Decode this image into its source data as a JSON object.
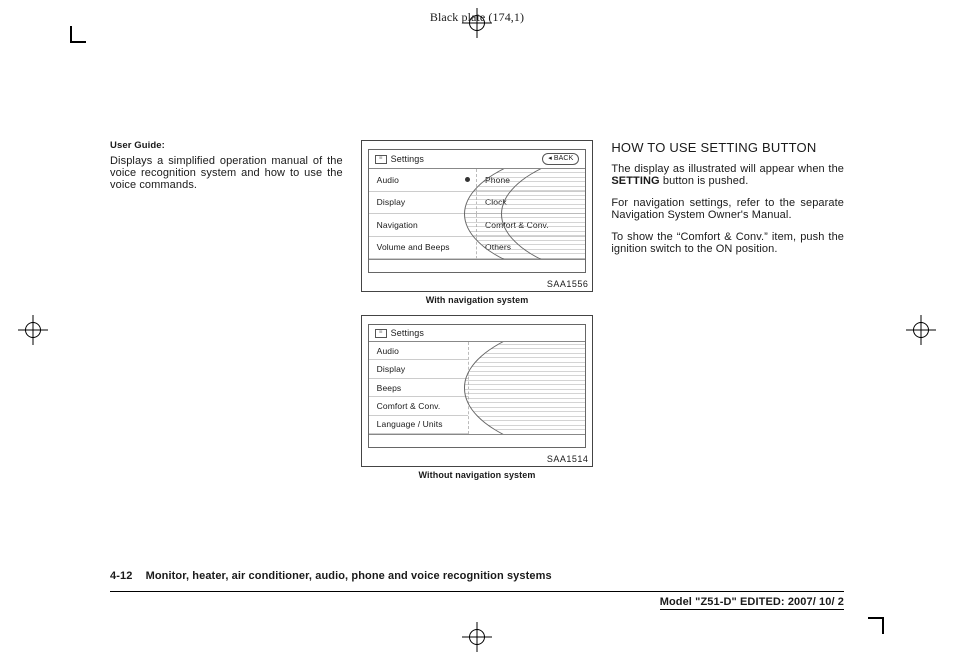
{
  "meta": {
    "plate_label": "Black plate (174,1)"
  },
  "col1": {
    "heading": "User Guide:",
    "paragraph": "Displays a simplified operation manual of the voice recognition system and how to use the voice commands."
  },
  "fig1": {
    "id": "SAA1556",
    "caption": "With navigation system",
    "title": "Settings",
    "back_label": "BACK",
    "menu_left": [
      "Audio",
      "Display",
      "Navigation",
      "Volume and Beeps"
    ],
    "menu_right": [
      "Phone",
      "Clock",
      "Comfort & Conv.",
      "Others"
    ]
  },
  "fig2": {
    "id": "SAA1514",
    "caption": "Without navigation system",
    "title": "Settings",
    "menu": [
      "Audio",
      "Display",
      "Beeps",
      "Comfort & Conv.",
      "Language / Units"
    ]
  },
  "col3": {
    "heading": "HOW TO USE SETTING BUTTON",
    "p1_a": "The display as illustrated will appear when the ",
    "p1_b_strong": "SETTING",
    "p1_c": " button is pushed.",
    "p2": "For navigation settings, refer to the separate Navigation System Owner's Manual.",
    "p3": "To show the “Comfort & Conv.” item, push the ignition switch to the ON position."
  },
  "footer": {
    "page": "4-12",
    "section": "Monitor, heater, air conditioner, audio, phone and voice recognition systems",
    "model_a": "Model ",
    "model_b": "\"Z51-D\"",
    "model_c": " EDITED: 2007/ 10/ 2"
  }
}
